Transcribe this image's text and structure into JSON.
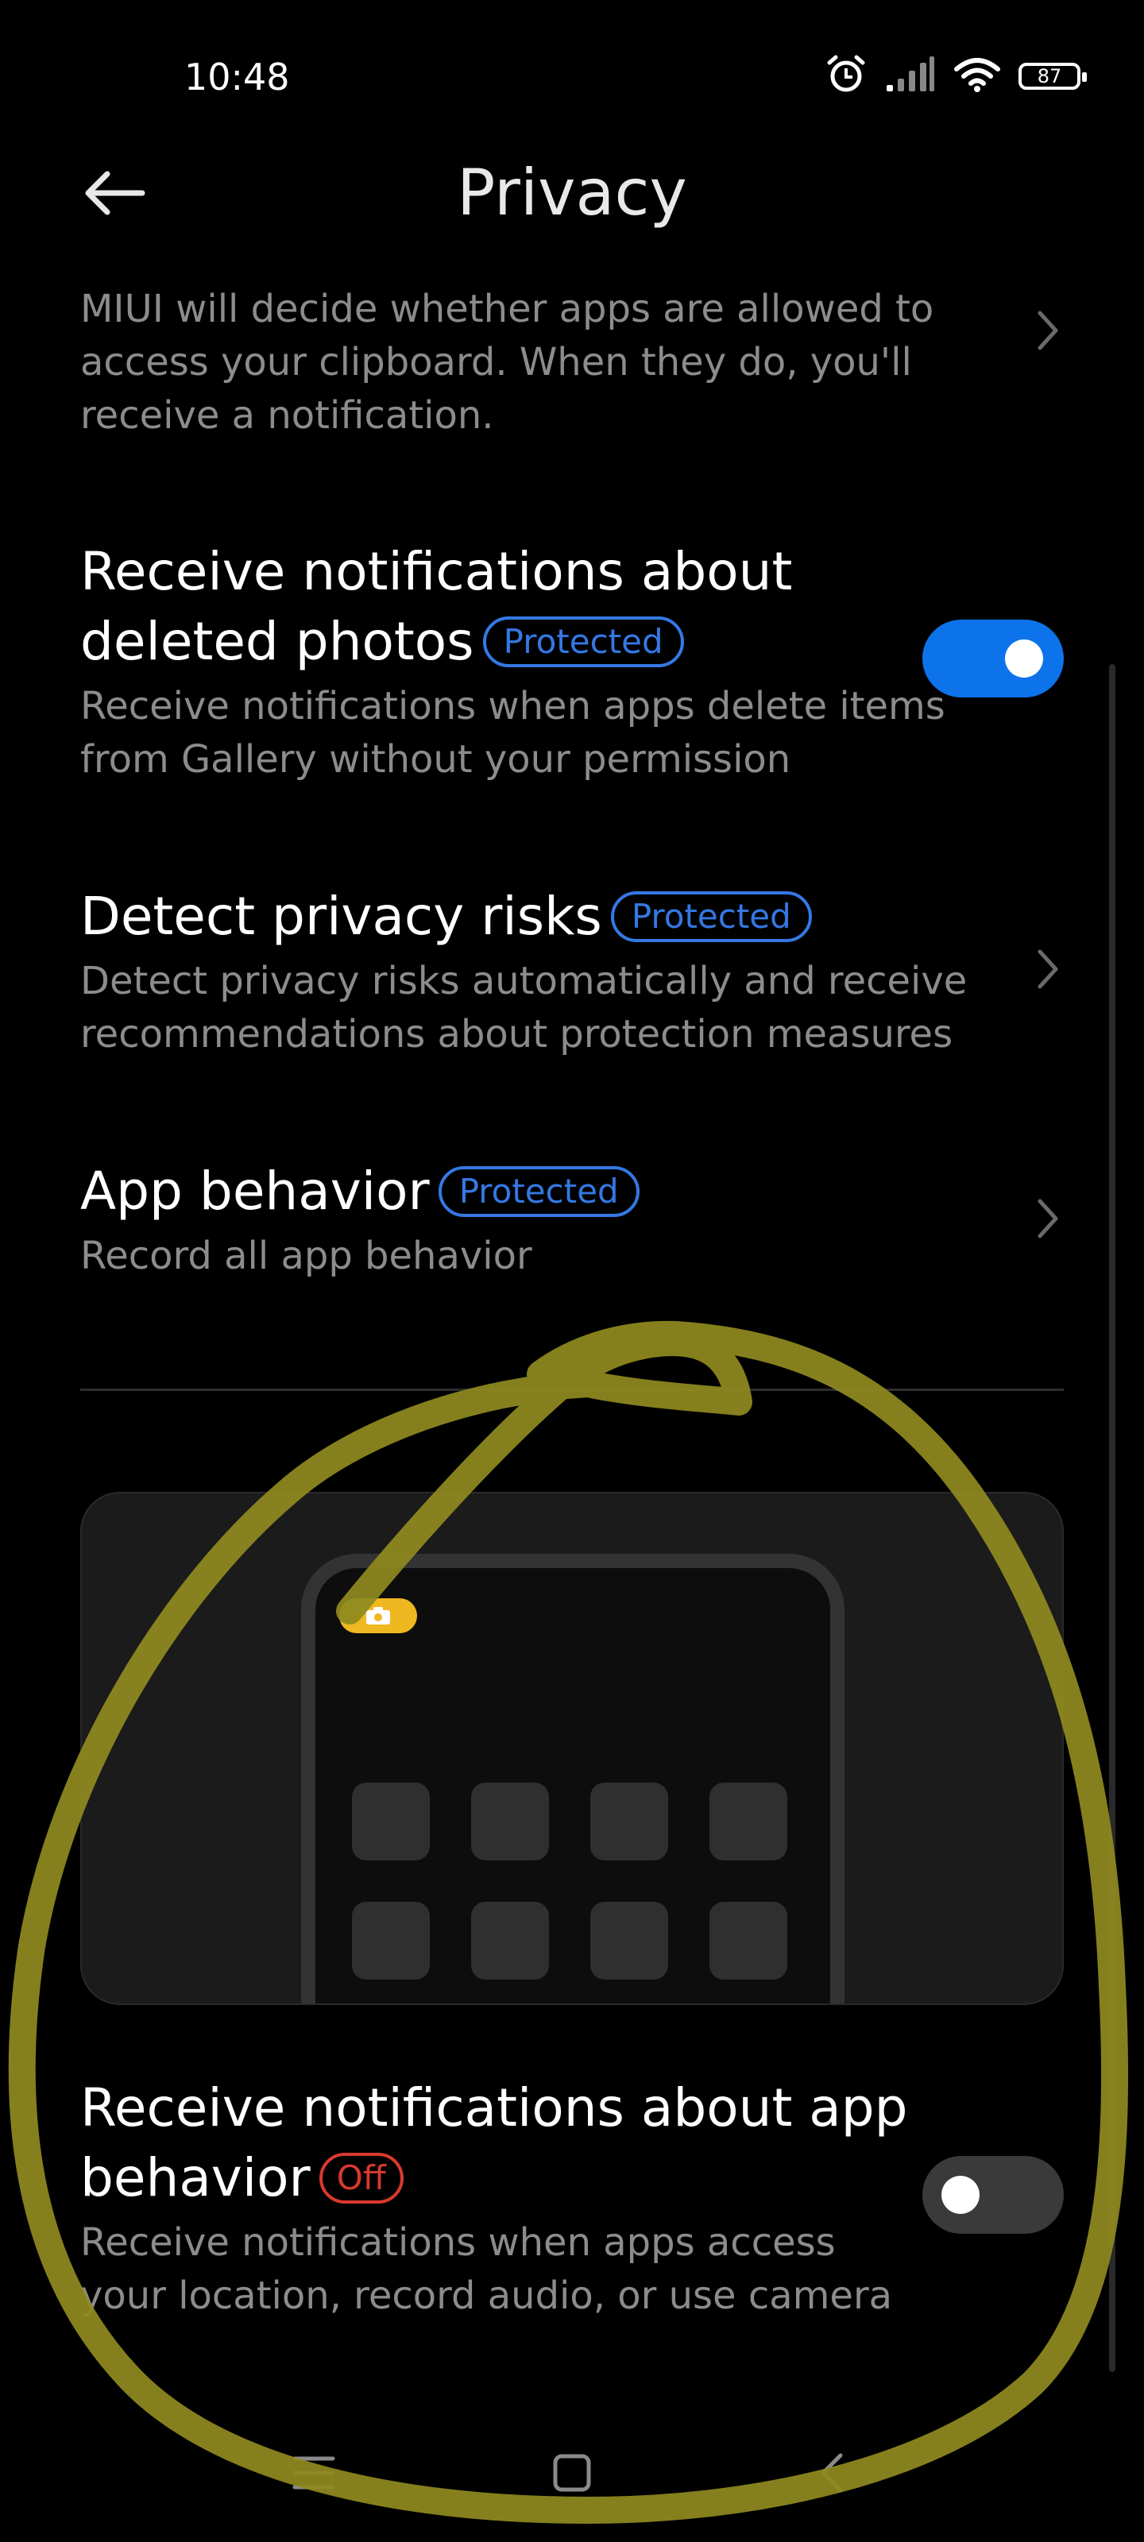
{
  "status_bar": {
    "time": "10:48",
    "battery": "87",
    "icons": [
      "alarm-icon",
      "signal-icon",
      "wifi-icon",
      "battery-icon"
    ]
  },
  "header": {
    "title": "Privacy",
    "back_icon": "arrow-left-icon"
  },
  "items": {
    "clipboard": {
      "description": "MIUI will decide whether apps are allowed to access your clipboard. When they do, you'll receive a notification."
    },
    "deleted_photos": {
      "title": "Receive notifications about deleted photos",
      "badge": "Protected",
      "description": "Receive notifications when apps delete items from Gallery without your permission",
      "toggle": "on"
    },
    "privacy_risks": {
      "title": "Detect privacy risks",
      "badge": "Protected",
      "description": "Detect privacy risks automatically and receive recommendations about protection measures"
    },
    "app_behavior": {
      "title": "App behavior",
      "badge": "Protected",
      "description": "Record all app behavior"
    },
    "app_behavior_notifications": {
      "title": "Receive notifications about app behavior",
      "badge": "Off",
      "description": "Receive notifications when apps access your location, record audio, or use camera",
      "toggle": "off"
    }
  },
  "colors": {
    "accent": "#0d73ea",
    "badge_blue": "#3478e4",
    "badge_red": "#d9392f",
    "annotation": "#8f8a1f"
  },
  "nav_bar": [
    "menu-icon",
    "home-icon",
    "back-icon"
  ]
}
